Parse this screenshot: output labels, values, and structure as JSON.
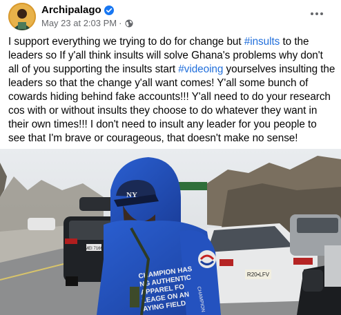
{
  "post": {
    "author": "Archipalago",
    "timestamp": "May 23 at 2:03 PM",
    "separator": "·",
    "audience_icon": "globe-icon",
    "verified_icon": "verified-badge-icon",
    "menu_icon": "more-options-icon",
    "text_segments": [
      "I support everything we trying to do for change but ",
      "#insults",
      " to the leaders so If y'all think insults will solve Ghana's problems why don't all of you supporting the insults start ",
      "#videoing",
      " yourselves insulting the leaders so that the change y'all want comes! Y'all some bunch of cowards hiding behind fake accounts!!! Y'all need to do your research cos with or without insults they choose to do whatever they want in their own times!!! I don't need to insult any leader for you people to see that I'm brave or courageous, that doesn't make no sense!"
    ],
    "photo": {
      "plate_left": "MEI 7166",
      "plate_right": "R20•LFV",
      "cap_logo": "NY",
      "shirt_text": [
        "CHAMPION HAS",
        "NG AUTHENTIC",
        "APPAREL FO",
        "LEAGE ON AN",
        "AYING FIELD"
      ],
      "sleeve_text": "CHAMPION"
    }
  },
  "colors": {
    "hashtag": "#216fdb",
    "verified": "#1877f2",
    "meta": "#65676b"
  }
}
